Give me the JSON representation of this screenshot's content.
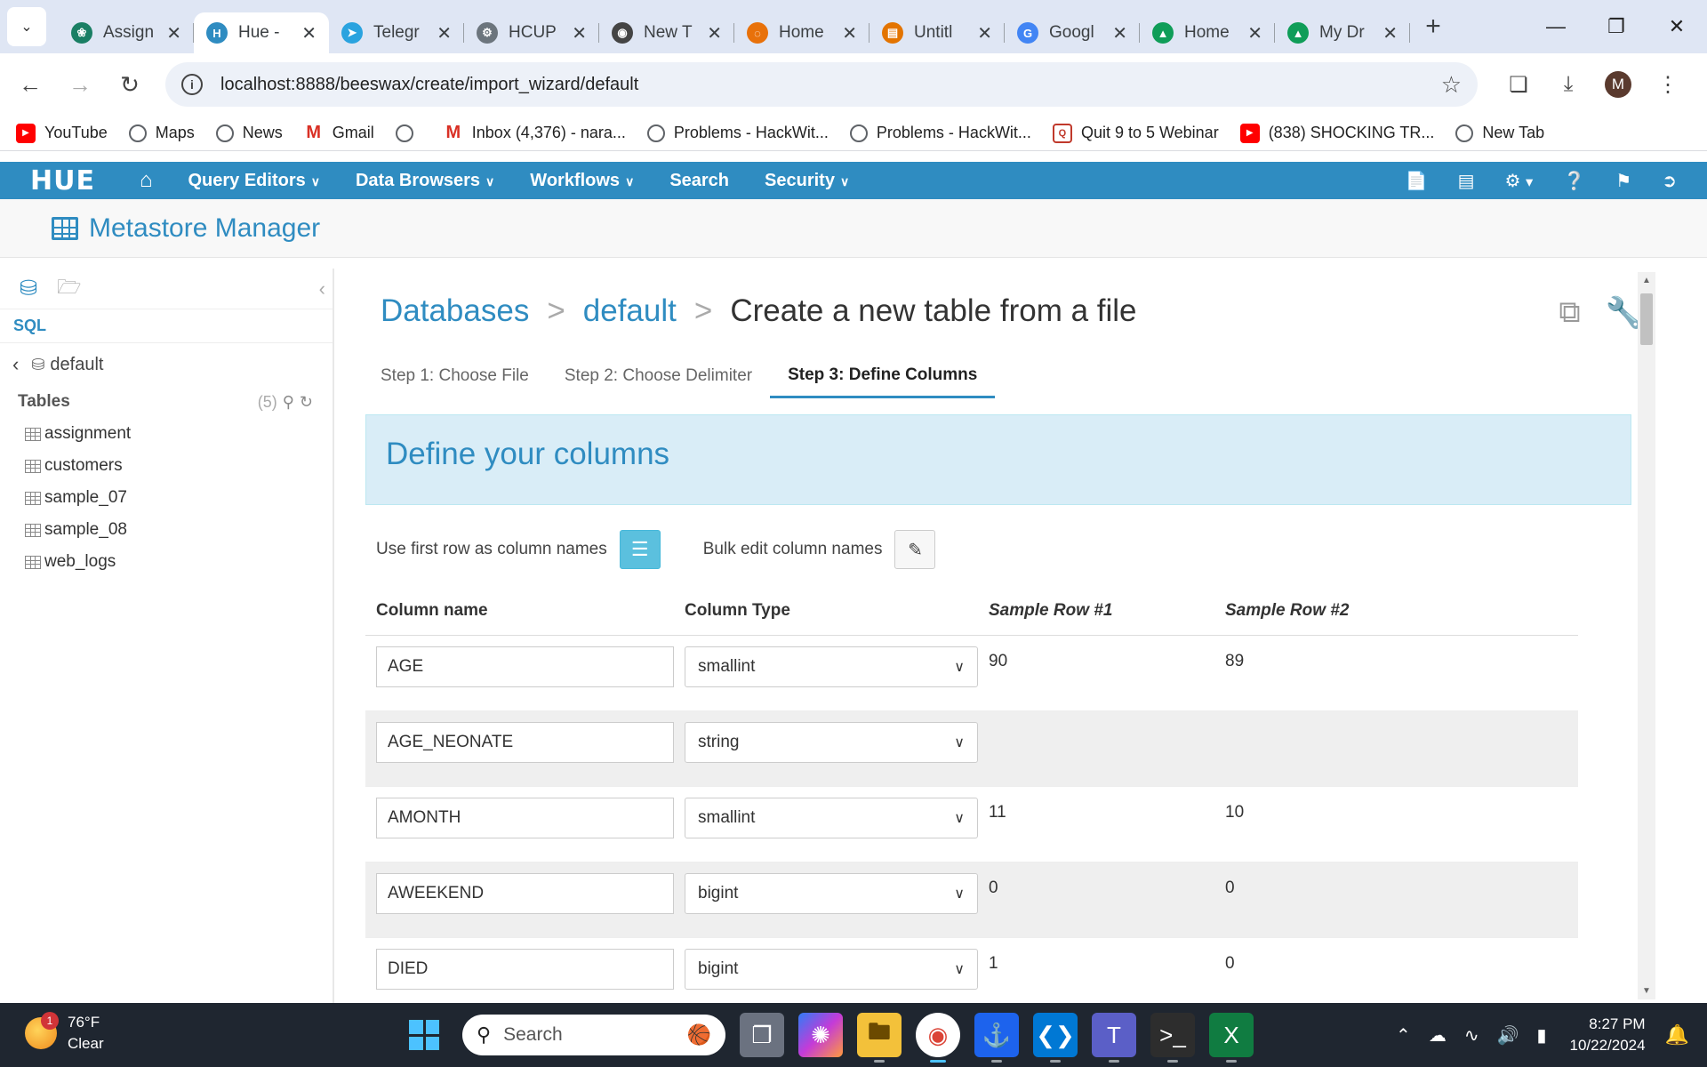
{
  "browser": {
    "tabs": [
      {
        "title": "Assign",
        "icon": "openai-icon",
        "color": "#1a7f64",
        "glyph": "❀"
      },
      {
        "title": "Hue - ",
        "icon": "hue-icon",
        "color": "#2f8cc1",
        "glyph": "H",
        "active": true
      },
      {
        "title": "Telegr",
        "icon": "telegram-icon",
        "color": "#2aa3df",
        "glyph": "➤"
      },
      {
        "title": "HCUP",
        "icon": "hcup-icon",
        "color": "#6c757d",
        "glyph": "⚙"
      },
      {
        "title": "New T",
        "icon": "chrome-icon",
        "color": "#444",
        "glyph": "◉"
      },
      {
        "title": "Home",
        "icon": "spinner-icon",
        "color": "#e8710a",
        "glyph": "◌"
      },
      {
        "title": "Untitl",
        "icon": "doc-icon",
        "color": "#e37400",
        "glyph": "▤"
      },
      {
        "title": "Googl",
        "icon": "google-icon",
        "color": "#4285f4",
        "glyph": "G"
      },
      {
        "title": "Home",
        "icon": "drive-icon",
        "color": "#0f9d58",
        "glyph": "▲"
      },
      {
        "title": "My Dr",
        "icon": "drive-icon",
        "color": "#0f9d58",
        "glyph": "▲"
      }
    ],
    "url": "localhost:8888/beeswax/create/import_wizard/default",
    "profile_initial": "M",
    "bookmarks": [
      {
        "label": "YouTube",
        "icon": "youtube-icon",
        "cls": "yt",
        "glyph": "▶"
      },
      {
        "label": "Maps",
        "icon": "globe-icon",
        "cls": "globe",
        "glyph": ""
      },
      {
        "label": "News",
        "icon": "globe-icon",
        "cls": "globe",
        "glyph": ""
      },
      {
        "label": "Gmail",
        "icon": "gmail-icon",
        "cls": "gm",
        "glyph": "M"
      },
      {
        "label": "",
        "icon": "globe-icon",
        "cls": "globe",
        "glyph": ""
      },
      {
        "label": "Inbox (4,376) - nara...",
        "icon": "gmail-icon",
        "cls": "gm",
        "glyph": "M"
      },
      {
        "label": "Problems - HackWit...",
        "icon": "globe-icon",
        "cls": "globe",
        "glyph": ""
      },
      {
        "label": "Problems - HackWit...",
        "icon": "globe-icon",
        "cls": "globe",
        "glyph": ""
      },
      {
        "label": "Quit 9 to 5 Webinar",
        "icon": "webinar-icon",
        "cls": "q",
        "glyph": "Q"
      },
      {
        "label": "(838) SHOCKING TR...",
        "icon": "youtube-icon",
        "cls": "yt",
        "glyph": "▶"
      },
      {
        "label": "New Tab",
        "icon": "globe-icon",
        "cls": "globe",
        "glyph": ""
      }
    ]
  },
  "hue": {
    "logo": "HUE",
    "menus": [
      {
        "label": "Query Editors",
        "dropdown": true
      },
      {
        "label": "Data Browsers",
        "dropdown": true
      },
      {
        "label": "Workflows",
        "dropdown": true
      },
      {
        "label": "Search",
        "dropdown": false
      },
      {
        "label": "Security",
        "dropdown": true
      }
    ],
    "app_title": "Metastore Manager"
  },
  "sidebar": {
    "section": "SQL",
    "database": "default",
    "tables_label": "Tables",
    "tables_count": "(5)",
    "tables": [
      "assignment",
      "customers",
      "sample_07",
      "sample_08",
      "web_logs"
    ]
  },
  "main": {
    "breadcrumb": {
      "databases": "Databases",
      "db": "default",
      "current": "Create a new table from a file",
      "sep": ">"
    },
    "steps": [
      "Step 1: Choose File",
      "Step 2: Choose Delimiter",
      "Step 3: Define Columns"
    ],
    "active_step": 2,
    "banner": "Define your columns",
    "use_first_row_label": "Use first row as column names",
    "bulk_edit_label": "Bulk edit column names",
    "headers": {
      "name": "Column name",
      "type": "Column Type",
      "sample1": "Sample Row #1",
      "sample2": "Sample Row #2"
    },
    "columns": [
      {
        "name": "AGE",
        "type": "smallint",
        "s1": "90",
        "s2": "89"
      },
      {
        "name": "AGE_NEONATE",
        "type": "string",
        "s1": "",
        "s2": ""
      },
      {
        "name": "AMONTH",
        "type": "smallint",
        "s1": "11",
        "s2": "10"
      },
      {
        "name": "AWEEKEND",
        "type": "bigint",
        "s1": "0",
        "s2": "0"
      },
      {
        "name": "DIED",
        "type": "bigint",
        "s1": "1",
        "s2": "0"
      }
    ]
  },
  "taskbar": {
    "weather_temp": "76°F",
    "weather_desc": "Clear",
    "notifications": "1",
    "search_placeholder": "Search",
    "time": "8:27 PM",
    "date": "10/22/2024"
  },
  "colors": {
    "hue_blue": "#2f8cc1",
    "banner_bg": "#d9edf7",
    "btn_info": "#5bc0de"
  }
}
